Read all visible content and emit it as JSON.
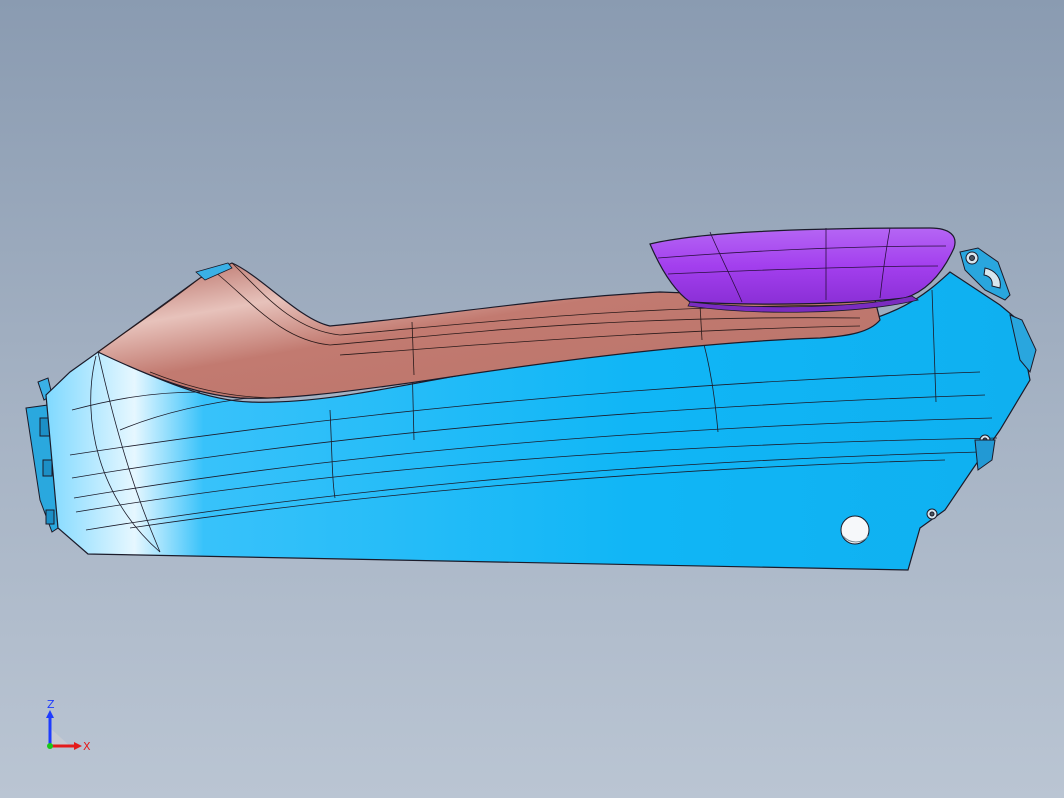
{
  "viewport": {
    "background_top": "#8a9bb1",
    "background_bottom": "#bac5d3"
  },
  "model": {
    "body_color": "#11b8f8",
    "tray_color": "#c47f74",
    "armrest_color": "#a640f0",
    "edge_color": "#1b1b2a"
  },
  "triad": {
    "z_label": "Z",
    "x_label": "X",
    "z_color": "#1e3cff",
    "x_color": "#e41b1b",
    "origin_color": "#18c818"
  }
}
